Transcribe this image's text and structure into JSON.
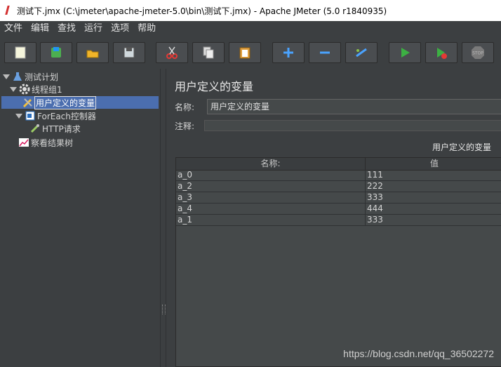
{
  "window": {
    "title": "测试下.jmx (C:\\jmeter\\apache-jmeter-5.0\\bin\\测试下.jmx) - Apache JMeter (5.0 r1840935)"
  },
  "menu": [
    "文件",
    "编辑",
    "查找",
    "运行",
    "选项",
    "帮助"
  ],
  "toolbar": [
    {
      "name": "new-icon"
    },
    {
      "name": "templates-icon"
    },
    {
      "name": "open-icon"
    },
    {
      "name": "save-icon"
    },
    {
      "name": "cut-icon"
    },
    {
      "name": "copy-icon"
    },
    {
      "name": "paste-icon"
    },
    {
      "name": "expand-icon"
    },
    {
      "name": "collapse-icon"
    },
    {
      "name": "toggle-icon"
    },
    {
      "name": "start-icon"
    },
    {
      "name": "start-no-pause-icon"
    },
    {
      "name": "stop-icon"
    }
  ],
  "stop_label": "STOP",
  "tree": {
    "test_plan": "测试计划",
    "thread_group": "线程组1",
    "user_vars": "用户定义的变量",
    "foreach": "ForEach控制器",
    "http": "HTTP请求",
    "results_tree": "察看结果树"
  },
  "panel": {
    "title": "用户定义的变量",
    "name_label": "名称:",
    "name_value": "用户定义的变量",
    "comment_label": "注释:",
    "section_title": "用户定义的变量",
    "columns": [
      "名称:",
      "值"
    ],
    "rows": [
      {
        "name": "a_0",
        "value": "111"
      },
      {
        "name": "a_2",
        "value": "222"
      },
      {
        "name": "a_3",
        "value": "333"
      },
      {
        "name": "a_4",
        "value": "444"
      },
      {
        "name": "a_1",
        "value": "333"
      }
    ]
  },
  "watermark": "https://blog.csdn.net/qq_36502272"
}
